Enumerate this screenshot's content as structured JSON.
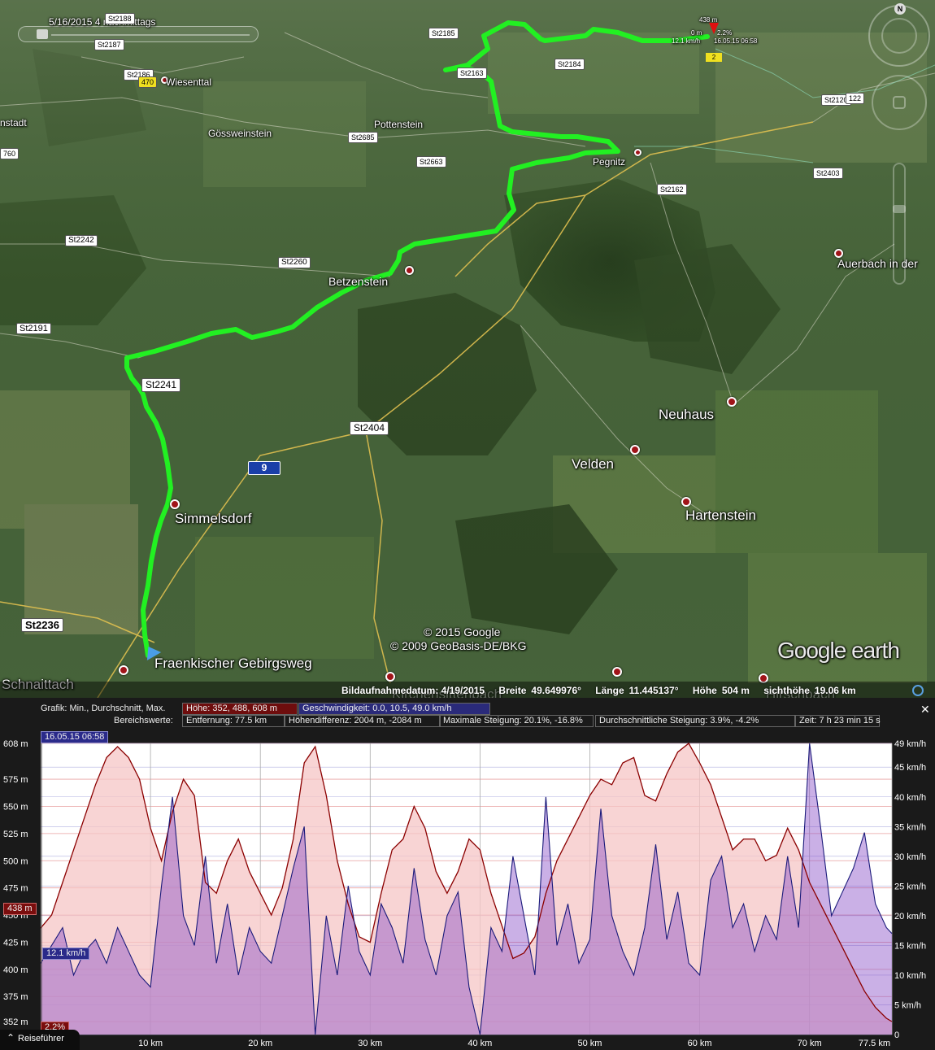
{
  "map": {
    "timestamp": "5/16/2015   4 nachmittags",
    "compass": "N",
    "copyright_1": "© 2015 Google",
    "copyright_2": "© 2009 GeoBasis-DE/BKG",
    "logo": "Google earth",
    "current_point": {
      "elevation": "438 m",
      "distance": "0 m",
      "grade": "2.2%",
      "speed": "12.1 km/h",
      "time": "16.05.15 06:58",
      "marker": "2"
    },
    "places": [
      {
        "name": "Wiesenttal",
        "size": "sm"
      },
      {
        "name": "Gössweinstein",
        "size": "sm"
      },
      {
        "name": "Pottenstein",
        "size": "sm"
      },
      {
        "name": "nstadt",
        "size": "sm"
      },
      {
        "name": "Pegnitz",
        "size": "sm"
      },
      {
        "name": "Auerbach in der",
        "size": "md"
      },
      {
        "name": "Betzenstein",
        "size": "md"
      },
      {
        "name": "Neuhaus",
        "size": "lg"
      },
      {
        "name": "Velden",
        "size": "lg"
      },
      {
        "name": "Hartenstein",
        "size": "lg"
      },
      {
        "name": "Simmelsdorf",
        "size": "lg"
      },
      {
        "name": "Schnaittach",
        "size": "lg"
      },
      {
        "name": "Fraenkischer Gebirgsweg",
        "size": "lg"
      }
    ],
    "roads": [
      "St2188",
      "St2187",
      "St2185",
      "St2186",
      "470",
      "St2163",
      "St2184",
      "St2685",
      "St2663",
      "760",
      "St2162",
      "St2403",
      "St2120",
      "122",
      "St2242",
      "St2260",
      "St2191",
      "St2241",
      "St2404",
      "9",
      "St2236"
    ],
    "status": {
      "imagery_date": "Bildaufnahmedatum: 4/19/2015",
      "lat_label": "Breite",
      "lat": "49.649976°",
      "lon_label": "Länge",
      "lon": "11.445137°",
      "height_label": "Höhe",
      "height": "504 m",
      "eye_label": "sichthöhe",
      "eye": "19.06 km"
    },
    "hidden_labels": [
      "Kirchensittenbach",
      "Hirschbach"
    ]
  },
  "profile": {
    "graph_label": "Grafik: Min., Durchschnitt, Max.",
    "height_stats": "Höhe: 352, 488, 608 m",
    "speed_stats": "Geschwindigkeit: 0.0, 10.5, 49.0 km/h",
    "range_label": "Bereichswerte:",
    "distance": "Entfernung: 77.5 km",
    "elev_diff": "Höhendifferenz: 2004 m, -2084 m",
    "max_grade": "Maximale Steigung: 20.1%, -16.8%",
    "avg_grade": "Durchschnittliche Steigung: 3.9%, -4.2%",
    "time": "Zeit: 7 h 23 min 15 s",
    "close": "✕",
    "cursor_time": "16.05.15 06:58",
    "cursor_elev": "438 m",
    "cursor_speed": "12.1 km/h",
    "cursor_grade": "2.2%",
    "tour_guide": "Reiseführer",
    "tour_guide_icon": "chevron-up-icon"
  },
  "chart_data": {
    "type": "area",
    "xlabel": "",
    "ylabel_left": "",
    "ylabel_right": "",
    "x_ticks": [
      "10 km",
      "20 km",
      "30 km",
      "40 km",
      "50 km",
      "60 km",
      "70 km",
      "77.5 km"
    ],
    "x_tick_values": [
      10,
      20,
      30,
      40,
      50,
      60,
      70,
      77.5
    ],
    "xlim": [
      0,
      77.5
    ],
    "y_left_ticks": [
      "608 m",
      "575 m",
      "550 m",
      "525 m",
      "500 m",
      "475 m",
      "450 m",
      "425 m",
      "400 m",
      "375 m",
      "352 m"
    ],
    "y_left_values": [
      608,
      575,
      550,
      525,
      500,
      475,
      450,
      425,
      400,
      375,
      352
    ],
    "ylim_left": [
      340,
      608
    ],
    "y_right_ticks": [
      "49 km/h",
      "45 km/h",
      "40 km/h",
      "35 km/h",
      "30 km/h",
      "25 km/h",
      "20 km/h",
      "15 km/h",
      "10 km/h",
      "5 km/h",
      "0"
    ],
    "y_right_values": [
      49,
      45,
      40,
      35,
      30,
      25,
      20,
      15,
      10,
      5,
      0
    ],
    "ylim_right": [
      0,
      49
    ],
    "series": [
      {
        "name": "Höhe",
        "color": "#8b0000",
        "fill": "#f5c6c6",
        "x": [
          0,
          1,
          2,
          3,
          4,
          5,
          6,
          7,
          8,
          9,
          10,
          11,
          12,
          13,
          14,
          15,
          16,
          17,
          18,
          19,
          20,
          21,
          22,
          23,
          24,
          25,
          26,
          27,
          28,
          29,
          30,
          31,
          32,
          33,
          34,
          35,
          36,
          37,
          38,
          39,
          40,
          41,
          42,
          43,
          44,
          45,
          46,
          47,
          48,
          49,
          50,
          51,
          52,
          53,
          54,
          55,
          56,
          57,
          58,
          59,
          60,
          61,
          62,
          63,
          64,
          65,
          66,
          67,
          68,
          69,
          70,
          71,
          72,
          73,
          74,
          75,
          76,
          77,
          77.5
        ],
        "values": [
          438,
          450,
          480,
          510,
          540,
          570,
          595,
          605,
          595,
          575,
          530,
          500,
          545,
          575,
          560,
          480,
          470,
          500,
          520,
          490,
          470,
          450,
          475,
          520,
          590,
          605,
          560,
          500,
          460,
          430,
          425,
          470,
          510,
          520,
          550,
          530,
          490,
          470,
          490,
          520,
          510,
          470,
          440,
          410,
          415,
          430,
          470,
          500,
          520,
          540,
          560,
          575,
          570,
          590,
          595,
          560,
          555,
          580,
          600,
          608,
          590,
          570,
          540,
          510,
          520,
          520,
          500,
          505,
          530,
          510,
          480,
          460,
          440,
          420,
          400,
          380,
          365,
          355,
          352
        ]
      },
      {
        "name": "Geschwindigkeit",
        "color": "#1a1a7a",
        "fill": "#c8c8f0",
        "x": [
          0,
          1,
          2,
          3,
          4,
          5,
          6,
          7,
          8,
          9,
          10,
          11,
          12,
          13,
          14,
          15,
          16,
          17,
          18,
          19,
          20,
          21,
          22,
          23,
          24,
          25,
          26,
          27,
          28,
          29,
          30,
          31,
          32,
          33,
          34,
          35,
          36,
          37,
          38,
          39,
          40,
          41,
          42,
          43,
          44,
          45,
          46,
          47,
          48,
          49,
          50,
          51,
          52,
          53,
          54,
          55,
          56,
          57,
          58,
          59,
          60,
          61,
          62,
          63,
          64,
          65,
          66,
          67,
          68,
          69,
          70,
          71,
          72,
          73,
          74,
          75,
          76,
          77,
          77.5
        ],
        "values": [
          12,
          15,
          18,
          10,
          14,
          16,
          12,
          18,
          14,
          10,
          8,
          25,
          40,
          20,
          15,
          30,
          12,
          22,
          10,
          18,
          14,
          12,
          20,
          28,
          35,
          0,
          20,
          10,
          25,
          14,
          10,
          22,
          18,
          12,
          28,
          16,
          10,
          20,
          24,
          8,
          0,
          18,
          14,
          30,
          20,
          10,
          40,
          15,
          22,
          12,
          16,
          38,
          20,
          14,
          10,
          18,
          32,
          16,
          24,
          12,
          10,
          26,
          30,
          18,
          22,
          14,
          20,
          16,
          30,
          18,
          49,
          35,
          20,
          24,
          28,
          34,
          22,
          18,
          17
        ]
      }
    ]
  }
}
